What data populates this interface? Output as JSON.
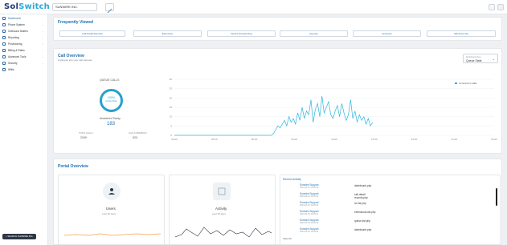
{
  "app": {
    "logo_a": "Sol",
    "logo_b": "Switch",
    "company": "SUNWIRE INC."
  },
  "sidebar": {
    "items": [
      {
        "label": "Dashboard"
      },
      {
        "label": "Phone System"
      },
      {
        "label": "Outbound Dialers"
      },
      {
        "label": "Reporting"
      },
      {
        "label": "Provisioning"
      },
      {
        "label": "Billing & Rates"
      },
      {
        "label": "Advanced Tools"
      },
      {
        "label": "Security"
      },
      {
        "label": "Wikis"
      }
    ],
    "search_button": "SEARCH SUNWIRE INC."
  },
  "frequently_viewed": {
    "title": "Frequently Viewed",
    "buttons": [
      "Call Detail Records",
      "Extension",
      "Device Provisioning",
      "Queues",
      "Accounts",
      "SIP Accounts"
    ]
  },
  "call_overview": {
    "title": "Call Overview",
    "subtitle": "A glimpse into your call volumes",
    "select_label": "Dashboard View",
    "select_value": "Queue Stats",
    "queue_calls_label": "QUEUE CALLS",
    "ring_value": "100%",
    "ring_label": "Answer Rate",
    "answered_label": "Answered Today",
    "answered_value": "183",
    "total_label": "TOTAL CALLS",
    "total_value": "2349",
    "abandon_label": "CALLS ABANDON",
    "abandon_value": "520"
  },
  "chart_data": {
    "type": "line",
    "series": [
      {
        "name": "Concurrent Calls",
        "values": [
          0,
          0,
          0,
          0,
          0,
          0,
          0,
          0,
          0,
          0,
          0,
          0,
          0,
          0,
          0,
          0,
          0,
          0,
          0,
          0,
          0,
          0,
          0,
          0,
          0,
          0,
          0,
          0,
          0,
          0,
          0,
          0,
          0,
          0,
          0,
          0,
          0,
          0,
          0,
          0,
          0,
          0,
          0,
          0,
          0,
          1,
          3,
          5,
          4,
          6,
          8,
          5,
          10,
          7,
          9,
          6,
          12,
          8,
          15,
          9,
          13,
          11,
          19,
          7,
          14,
          17,
          10,
          21,
          12,
          15,
          18,
          11,
          9,
          13,
          16,
          10,
          17,
          12,
          8,
          11,
          19,
          9,
          13,
          7,
          11,
          8,
          10,
          6,
          9,
          5,
          7
        ]
      }
    ],
    "x_ticks": [
      "00:00",
      "03:00",
      "06:00",
      "09:00",
      "12:00",
      "15:00",
      "18:00",
      "21:00",
      "00:00"
    ],
    "y_ticks": [
      0,
      5,
      10,
      15,
      20,
      25,
      30
    ],
    "ylim": [
      0,
      30
    ],
    "legend": "top-right",
    "color": "#2fb5df"
  },
  "portal_overview": {
    "title": "Portal Overview",
    "users_label": "Users",
    "users_sub": "Last 30 days",
    "activity_label": "Activity",
    "activity_sub": "Last 30 days",
    "recent_activity_title": "Recent Activity",
    "rows": [
      {
        "name": "Sunwire Support",
        "date": "2024-04-15 10:29:45",
        "page": "dashboard.php"
      },
      {
        "name": "Sunwire Support",
        "date": "2024-04-15 10:29:40",
        "page": "call-detail-records.php"
      },
      {
        "name": "Sunwire Support",
        "date": "2024-04-15 10:29:33",
        "page": "ivr-list.php"
      },
      {
        "name": "Sunwire Support",
        "date": "2024-04-15 10:29:21",
        "page": "extensions-list.php"
      },
      {
        "name": "Sunwire Support",
        "date": "2024-04-15 10:29:15",
        "page": "queue-list.php"
      },
      {
        "name": "Sunwire Support",
        "date": "2024-04-15 10:29:02",
        "page": "dashboard.php"
      }
    ],
    "view_all": "View All"
  }
}
